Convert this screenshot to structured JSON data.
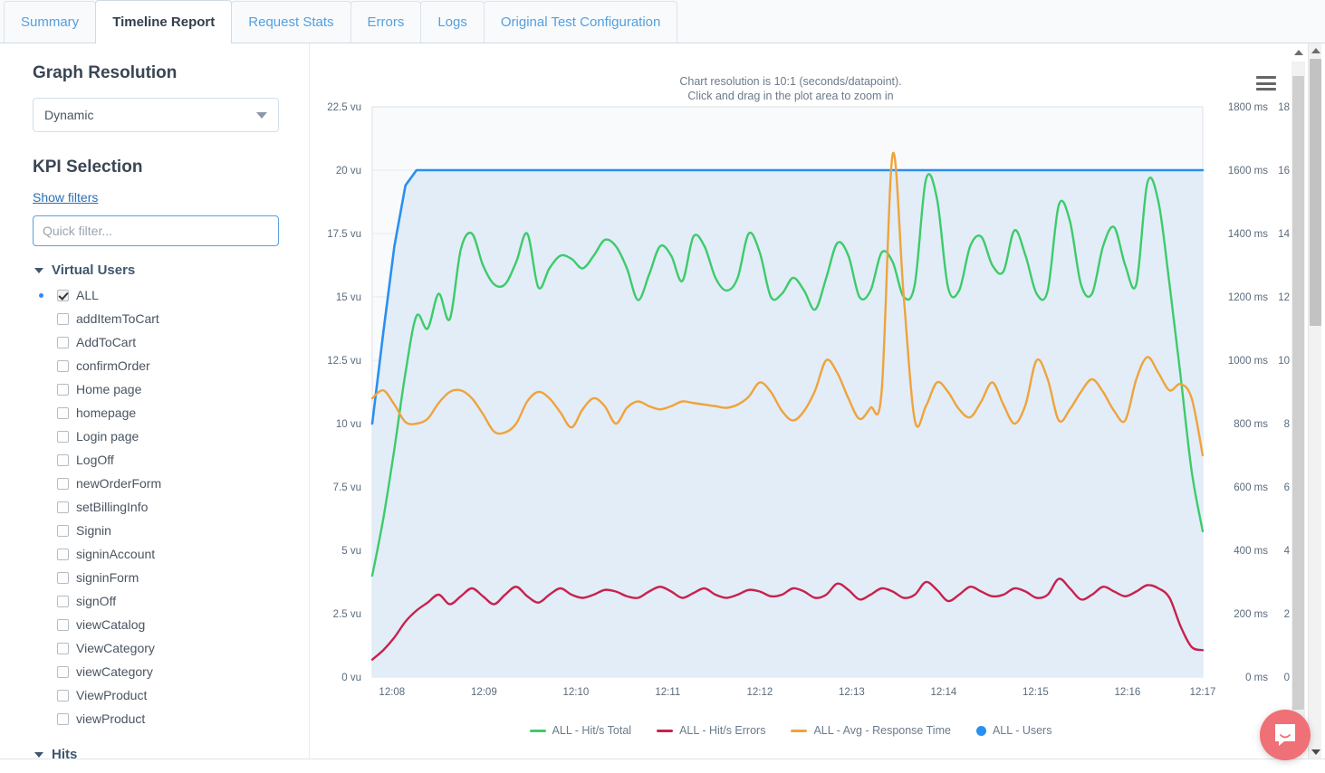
{
  "tabs": [
    {
      "label": "Summary",
      "active": false
    },
    {
      "label": "Timeline Report",
      "active": true
    },
    {
      "label": "Request Stats",
      "active": false
    },
    {
      "label": "Errors",
      "active": false
    },
    {
      "label": "Logs",
      "active": false
    },
    {
      "label": "Original Test Configuration",
      "active": false
    }
  ],
  "sidebar": {
    "graph_resolution_title": "Graph Resolution",
    "resolution_value": "Dynamic",
    "kpi_title": "KPI Selection",
    "show_filters_label": "Show filters",
    "quick_filter_placeholder": "Quick filter...",
    "quick_filter_value": "",
    "groups": [
      {
        "name": "Virtual Users",
        "expanded": true,
        "items": [
          {
            "label": "ALL",
            "checked": true,
            "selected": true
          },
          {
            "label": "addItemToCart",
            "checked": false,
            "selected": false
          },
          {
            "label": "AddToCart",
            "checked": false,
            "selected": false
          },
          {
            "label": "confirmOrder",
            "checked": false,
            "selected": false
          },
          {
            "label": "Home page",
            "checked": false,
            "selected": false
          },
          {
            "label": "homepage",
            "checked": false,
            "selected": false
          },
          {
            "label": "Login page",
            "checked": false,
            "selected": false
          },
          {
            "label": "LogOff",
            "checked": false,
            "selected": false
          },
          {
            "label": "newOrderForm",
            "checked": false,
            "selected": false
          },
          {
            "label": "setBillingInfo",
            "checked": false,
            "selected": false
          },
          {
            "label": "Signin",
            "checked": false,
            "selected": false
          },
          {
            "label": "signinAccount",
            "checked": false,
            "selected": false
          },
          {
            "label": "signinForm",
            "checked": false,
            "selected": false
          },
          {
            "label": "signOff",
            "checked": false,
            "selected": false
          },
          {
            "label": "viewCatalog",
            "checked": false,
            "selected": false
          },
          {
            "label": "ViewCategory",
            "checked": false,
            "selected": false
          },
          {
            "label": "viewCategory",
            "checked": false,
            "selected": false
          },
          {
            "label": "ViewProduct",
            "checked": false,
            "selected": false
          },
          {
            "label": "viewProduct",
            "checked": false,
            "selected": false
          }
        ]
      },
      {
        "name": "Hits",
        "expanded": true,
        "items": []
      }
    ]
  },
  "chart_header": {
    "line1": "Chart resolution is 10:1 (seconds/datapoint).",
    "line2": "Click and drag in the plot area to zoom in",
    "menu_icon": "hamburger-menu-icon"
  },
  "colors": {
    "hits_total": "#3ecb6a",
    "hits_errors": "#c8224c",
    "response_time": "#f0a33c",
    "users": "#2a8ff0",
    "users_fill": "#e2edf8",
    "plot_bg_upper": "#f9fafb",
    "grid": "#e3ebf3",
    "axis_text": "#5b6b7c",
    "accent": "#54a0e0"
  },
  "chart_data": {
    "type": "line",
    "title": "",
    "subtitle": "Chart resolution is 10:1 (seconds/datapoint). Click and drag in the plot area to zoom in",
    "xlabel": "",
    "grid": true,
    "legend_position": "bottom",
    "x_tick_labels": [
      "12:08",
      "12:09",
      "12:10",
      "12:11",
      "12:12",
      "12:13",
      "12:14",
      "12:15",
      "12:16",
      "12:17"
    ],
    "x_tick_positions": [
      0.0238,
      0.1345,
      0.2452,
      0.3559,
      0.4666,
      0.5773,
      0.688,
      0.7987,
      0.9094,
      1.0
    ],
    "axes": [
      {
        "id": "vu",
        "side": "left",
        "unit": "vu",
        "min": 0,
        "max": 22.5,
        "ticks": [
          0,
          2.5,
          5,
          7.5,
          10,
          12.5,
          15,
          17.5,
          20,
          22.5
        ],
        "tick_labels": [
          "0 vu",
          "2.5 vu",
          "5 vu",
          "7.5 vu",
          "10 vu",
          "12.5 vu",
          "15 vu",
          "17.5 vu",
          "20 vu",
          "22.5 vu"
        ]
      },
      {
        "id": "ms",
        "side": "right",
        "unit": "ms",
        "min": 0,
        "max": 1800,
        "ticks": [
          0,
          200,
          400,
          600,
          800,
          1000,
          1200,
          1400,
          1600,
          1800
        ],
        "tick_labels": [
          "0 ms",
          "200 ms",
          "400 ms",
          "600 ms",
          "800 ms",
          "1000 ms",
          "1200 ms",
          "1400 ms",
          "1600 ms",
          "1800 ms"
        ]
      },
      {
        "id": "hits",
        "side": "right",
        "unit": "",
        "min": 0,
        "max": 18,
        "ticks": [
          0,
          2,
          4,
          6,
          8,
          10,
          12,
          14,
          16,
          18
        ],
        "tick_labels": [
          "0",
          "2",
          "4",
          "6",
          "8",
          "10",
          "12",
          "14",
          "16",
          "18"
        ]
      }
    ],
    "series": [
      {
        "name": "ALL - Hit/s Total",
        "color": "#3ecb6a",
        "axis": "hits",
        "values": [
          3.2,
          5.0,
          7.2,
          9.6,
          11.4,
          11.0,
          12.1,
          11.3,
          13.5,
          14.0,
          13.0,
          12.4,
          12.4,
          13.1,
          14.0,
          12.3,
          12.9,
          13.3,
          13.2,
          12.9,
          13.3,
          13.8,
          13.6,
          12.9,
          11.9,
          12.7,
          13.6,
          13.3,
          12.5,
          13.9,
          13.6,
          12.6,
          12.2,
          12.6,
          14.0,
          13.4,
          12.0,
          12.1,
          12.6,
          12.2,
          11.6,
          12.6,
          13.7,
          13.3,
          12.0,
          12.2,
          13.4,
          13.1,
          12.0,
          12.4,
          15.7,
          15.1,
          12.3,
          12.2,
          13.6,
          13.9,
          13.0,
          12.8,
          14.1,
          13.3,
          12.1,
          12.2,
          14.9,
          14.4,
          12.4,
          12.1,
          13.6,
          14.2,
          13.0,
          12.4,
          15.6,
          15.0,
          12.4,
          9.5,
          6.5,
          4.6
        ]
      },
      {
        "name": "ALL - Hit/s Errors",
        "color": "#c8224c",
        "axis": "hits",
        "values": [
          0.55,
          0.85,
          1.25,
          1.75,
          2.1,
          2.35,
          2.6,
          2.3,
          2.55,
          2.8,
          2.55,
          2.3,
          2.6,
          2.85,
          2.55,
          2.35,
          2.6,
          2.8,
          2.6,
          2.5,
          2.6,
          2.75,
          2.7,
          2.55,
          2.5,
          2.7,
          2.85,
          2.7,
          2.5,
          2.65,
          2.8,
          2.6,
          2.5,
          2.6,
          2.75,
          2.7,
          2.55,
          2.6,
          2.8,
          2.7,
          2.5,
          2.6,
          2.95,
          2.75,
          2.45,
          2.6,
          2.8,
          2.7,
          2.5,
          2.6,
          3.0,
          2.75,
          2.4,
          2.6,
          2.85,
          2.7,
          2.55,
          2.6,
          2.8,
          2.7,
          2.5,
          2.6,
          3.1,
          2.8,
          2.45,
          2.6,
          2.85,
          2.7,
          2.55,
          2.7,
          2.9,
          2.8,
          2.5,
          1.6,
          0.95,
          0.85
        ]
      },
      {
        "name": "ALL - Avg - Response Time",
        "color": "#f0a33c",
        "axis": "ms",
        "values": [
          880,
          905,
          860,
          805,
          800,
          815,
          865,
          900,
          905,
          880,
          830,
          775,
          772,
          800,
          870,
          900,
          880,
          835,
          788,
          845,
          880,
          855,
          800,
          850,
          870,
          855,
          845,
          855,
          870,
          865,
          860,
          855,
          850,
          860,
          885,
          930,
          900,
          840,
          810,
          840,
          905,
          1000,
          960,
          880,
          815,
          850,
          900,
          1650,
          1200,
          810,
          855,
          930,
          900,
          845,
          820,
          870,
          930,
          860,
          800,
          860,
          1000,
          940,
          810,
          845,
          900,
          940,
          900,
          840,
          810,
          940,
          1010,
          960,
          905,
          925,
          880,
          700
        ]
      },
      {
        "name": "ALL - Users",
        "color": "#2a8ff0",
        "axis": "vu",
        "filled": true,
        "values": [
          10.0,
          13.6,
          17.0,
          19.4,
          20,
          20,
          20,
          20,
          20,
          20,
          20,
          20,
          20,
          20,
          20,
          20,
          20,
          20,
          20,
          20,
          20,
          20,
          20,
          20,
          20,
          20,
          20,
          20,
          20,
          20,
          20,
          20,
          20,
          20,
          20,
          20,
          20,
          20,
          20,
          20,
          20,
          20,
          20,
          20,
          20,
          20,
          20,
          20,
          20,
          20,
          20,
          20,
          20,
          20,
          20,
          20,
          20,
          20,
          20,
          20,
          20,
          20,
          20,
          20,
          20,
          20,
          20,
          20,
          20,
          20,
          20,
          20,
          20,
          20,
          20,
          20
        ]
      }
    ]
  },
  "legend": [
    {
      "label": "ALL - Hit/s Total",
      "color": "#3ecb6a",
      "marker": "line"
    },
    {
      "label": "ALL - Hit/s Errors",
      "color": "#c8224c",
      "marker": "line"
    },
    {
      "label": "ALL - Avg - Response Time",
      "color": "#f0a33c",
      "marker": "line"
    },
    {
      "label": "ALL - Users",
      "color": "#2a8ff0",
      "marker": "dot"
    }
  ],
  "chat_widget": {
    "icon": "chat-bubble-icon",
    "color": "#ef7076"
  }
}
